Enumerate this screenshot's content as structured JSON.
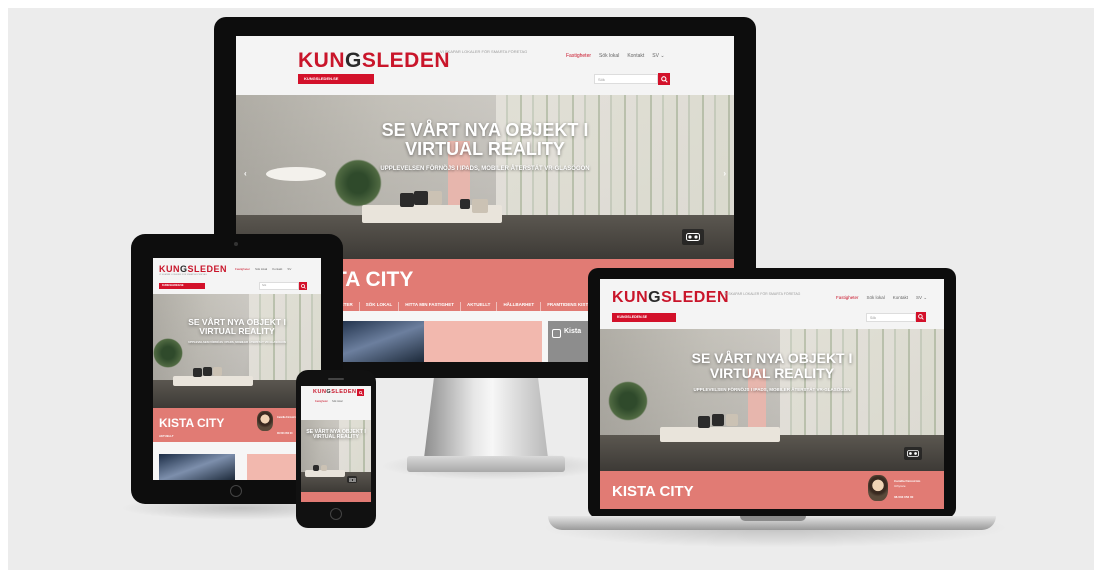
{
  "colors": {
    "brand_red": "#d3112a",
    "logo_red": "#c9152a",
    "pink_band": "#e17b74",
    "bezel": "#0d0d0d",
    "background": "#ececec"
  },
  "site": {
    "logo": {
      "part1": "KUN",
      "part2": "G",
      "part3": "SLEDEN"
    },
    "tagline": "VI SKAPAR LOKALER FÖR SMARTA FÖRETAG",
    "nav": [
      "Fastigheter",
      "Sök lokal",
      "Kontakt",
      "SV"
    ],
    "nav_chevron": "chevron-down-icon",
    "redbar_label": "KUNGSLEDEN.SE",
    "search_placeholder": "Sök",
    "hero_title_line1": "SE VÅRT NYA OBJEKT I",
    "hero_title_line2": "VIRTUAL REALITY",
    "hero_subtitle": "UPPLEVELSEN FÖRNÖJS I IPADS, MOBILER ÅTERSTÄT VR-GLASÖGON",
    "page_title": "KISTA CITY",
    "page_title_partial": "TA CITY",
    "tabs": [
      "LETER",
      "SÖK LOKAL",
      "HITTA MIN FASTIGHET",
      "AKTUELLT",
      "HÅLLBARHET",
      "FRAMTIDENS KISTA"
    ],
    "instagram_label": "Kista",
    "contact_name": "Camilla Färnström",
    "contact_role": "Uthyrare",
    "contact_phone": "08-503 052 00",
    "tablet_link": "AKTUELLT",
    "icons": {
      "search": "search-icon",
      "vr": "vr-glasses-icon",
      "instagram": "instagram-icon",
      "prev": "chevron-left-icon",
      "next": "chevron-right-icon"
    }
  }
}
